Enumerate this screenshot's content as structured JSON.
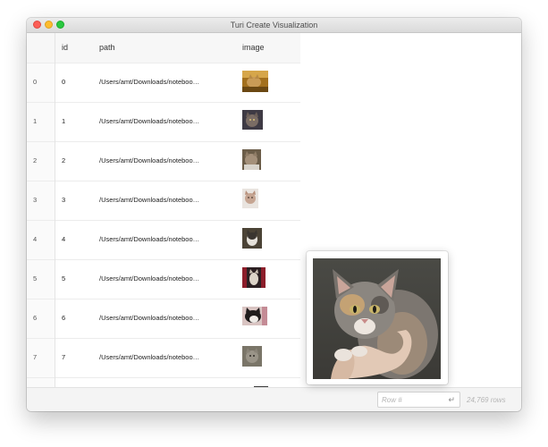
{
  "window": {
    "title": "Turi Create Visualization"
  },
  "table": {
    "columns": [
      "",
      "id",
      "path",
      "image"
    ],
    "rows": [
      {
        "index": "0",
        "id": "0",
        "path": "/Users/amt/Downloads/noteboo…",
        "image": "cat-photo"
      },
      {
        "index": "1",
        "id": "1",
        "path": "/Users/amt/Downloads/noteboo…",
        "image": "cat-photo"
      },
      {
        "index": "2",
        "id": "2",
        "path": "/Users/amt/Downloads/noteboo…",
        "image": "cat-photo"
      },
      {
        "index": "3",
        "id": "3",
        "path": "/Users/amt/Downloads/noteboo…",
        "image": "cat-photo"
      },
      {
        "index": "4",
        "id": "4",
        "path": "/Users/amt/Downloads/noteboo…",
        "image": "cat-photo"
      },
      {
        "index": "5",
        "id": "5",
        "path": "/Users/amt/Downloads/noteboo…",
        "image": "cat-photo"
      },
      {
        "index": "6",
        "id": "6",
        "path": "/Users/amt/Downloads/noteboo…",
        "image": "cat-photo"
      },
      {
        "index": "7",
        "id": "7",
        "path": "/Users/amt/Downloads/noteboo…",
        "image": "cat-photo"
      }
    ]
  },
  "preview": {
    "image": "kitten-held-in-hand-photo"
  },
  "footer": {
    "row_input_value": "",
    "row_input_placeholder": "Row #",
    "enter_icon": "↵",
    "row_count": "24,769 rows"
  },
  "colors": {
    "close": "#fc5f57",
    "minimize": "#fdbc2e",
    "maximize": "#29c840",
    "header_bg": "#f7f7f7",
    "footer_bg": "#f4f4f4"
  }
}
